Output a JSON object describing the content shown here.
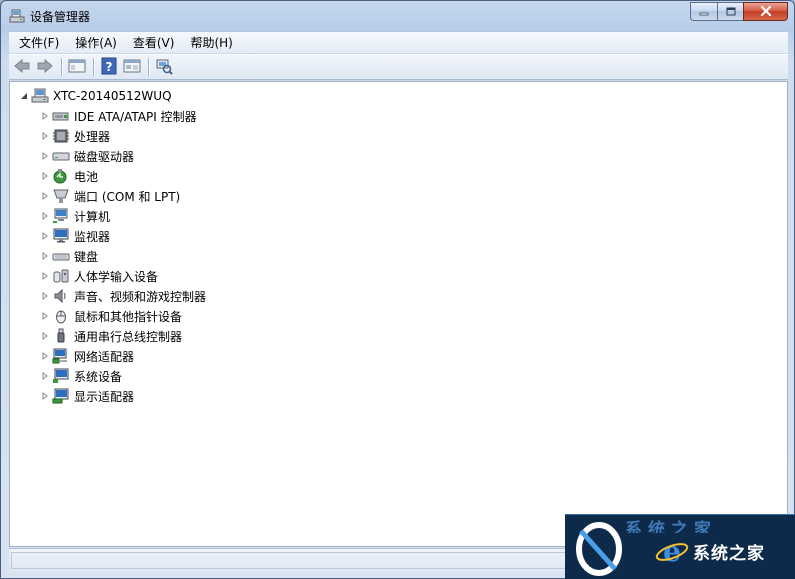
{
  "window": {
    "title": "设备管理器",
    "caption": {
      "minimize": "minimize-icon",
      "maximize": "maximize-icon",
      "close": "close-icon"
    }
  },
  "menu": {
    "items": [
      {
        "label": "文件(F)"
      },
      {
        "label": "操作(A)"
      },
      {
        "label": "查看(V)"
      },
      {
        "label": "帮助(H)"
      }
    ]
  },
  "toolbar": {
    "buttons": [
      "back-icon",
      "forward-icon",
      "show-hide-console-tree-icon",
      "help-icon",
      "properties-panel-icon",
      "scan-hardware-icon"
    ]
  },
  "tree": {
    "root": {
      "label": "XTC-20140512WUQ",
      "icon": "computer-icon",
      "expanded": true
    },
    "items": [
      {
        "label": "IDE ATA/ATAPI 控制器",
        "icon": "ide-controller-icon"
      },
      {
        "label": "处理器",
        "icon": "processor-icon"
      },
      {
        "label": "磁盘驱动器",
        "icon": "disk-drive-icon"
      },
      {
        "label": "电池",
        "icon": "battery-icon"
      },
      {
        "label": "端口 (COM 和 LPT)",
        "icon": "port-icon"
      },
      {
        "label": "计算机",
        "icon": "computer-icon"
      },
      {
        "label": "监视器",
        "icon": "monitor-icon"
      },
      {
        "label": "键盘",
        "icon": "keyboard-icon"
      },
      {
        "label": "人体学输入设备",
        "icon": "hid-icon"
      },
      {
        "label": "声音、视频和游戏控制器",
        "icon": "sound-icon"
      },
      {
        "label": "鼠标和其他指针设备",
        "icon": "mouse-icon"
      },
      {
        "label": "通用串行总线控制器",
        "icon": "usb-icon"
      },
      {
        "label": "网络适配器",
        "icon": "network-adapter-icon"
      },
      {
        "label": "系统设备",
        "icon": "system-device-icon"
      },
      {
        "label": "显示适配器",
        "icon": "display-adapter-icon"
      }
    ]
  },
  "watermark": {
    "text": "系统之家",
    "top_text": "系统之家"
  },
  "colors": {
    "titlebar": "#b8cde8",
    "close_button": "#c23e24",
    "content_bg": "#ffffff",
    "watermark_bg": "#0d2a4a"
  }
}
